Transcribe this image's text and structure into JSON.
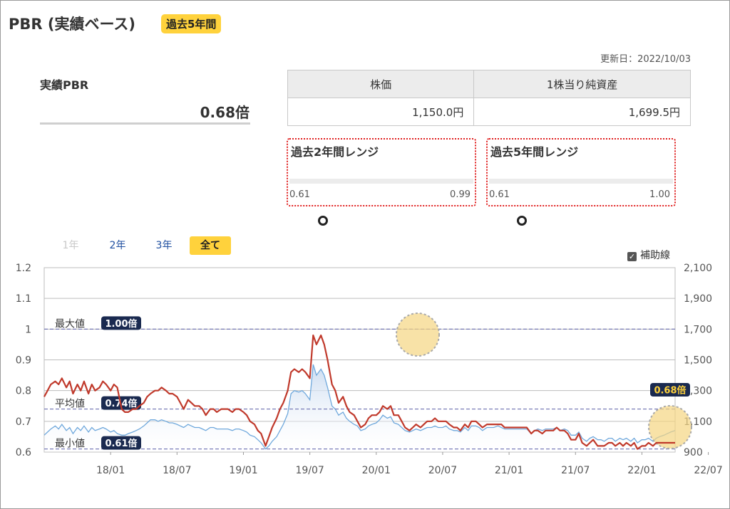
{
  "header": {
    "title": "PBR (実績ベース)",
    "period_badge": "過去5年間"
  },
  "updated": "更新日：2022/10/03",
  "pbr": {
    "label": "実績PBR",
    "value": "0.68倍"
  },
  "price_table": {
    "headers": [
      "株価",
      "1株当り純資産"
    ],
    "values": [
      "1,150.0円",
      "1,699.5円"
    ]
  },
  "ranges": [
    {
      "title": "過去2年間レンジ",
      "min": "0.61",
      "max": "0.99",
      "current": 0.68,
      "min_value": 0.61,
      "max_value": 0.99
    },
    {
      "title": "過去5年間レンジ",
      "min": "0.61",
      "max": "1.00",
      "current": 0.68,
      "min_value": 0.61,
      "max_value": 1.0
    }
  ],
  "tabs": [
    {
      "label": "1年",
      "state": "disabled"
    },
    {
      "label": "2年",
      "state": "link"
    },
    {
      "label": "3年",
      "state": "link"
    },
    {
      "label": "全て",
      "state": "active"
    }
  ],
  "aux_toggle": {
    "label": "補助線",
    "checked": true
  },
  "colors": {
    "pbr_line": "#c0392b",
    "price_line": "#6fa8dc",
    "price_fill": "#c9daf0",
    "badge": "#ffd23c",
    "label_bg": "#1a2a50",
    "highlight": "#f5d682"
  },
  "chart_data": {
    "type": "line",
    "x_tick_labels": [
      "18/01",
      "18/07",
      "19/01",
      "19/07",
      "20/01",
      "20/07",
      "21/01",
      "21/07",
      "22/01",
      "22/07"
    ],
    "y_left": {
      "ticks": [
        "1.2",
        "1.1",
        "1",
        "0.9",
        "0.8",
        "0.7",
        "0.6"
      ],
      "range": [
        0.6,
        1.2
      ]
    },
    "y_right": {
      "ticks": [
        "2,100",
        "1,900",
        "1,700",
        "1,500",
        "1,300",
        "1,100",
        "900"
      ],
      "range": [
        900,
        2100
      ]
    },
    "reference_lines": [
      {
        "label": "最大値",
        "badge": "1.00倍",
        "value": 1.0
      },
      {
        "label": "平均値",
        "badge": "0.74倍",
        "value": 0.74
      },
      {
        "label": "最小値",
        "badge": "0.61倍",
        "value": 0.61
      }
    ],
    "current_label": "0.68倍",
    "series": [
      {
        "axis": "left",
        "t": [
          0,
          0.3,
          0.6,
          1,
          1.3,
          1.6,
          2,
          2.3,
          2.6,
          3,
          3.3,
          3.6,
          4,
          4.3,
          4.6,
          5,
          5.3,
          5.6,
          6,
          6.3,
          6.6,
          7,
          7.3,
          7.6,
          8,
          8.3,
          8.6,
          9,
          9.3,
          9.6,
          10,
          10.3,
          10.6,
          11,
          11.3,
          11.6,
          12,
          12.3,
          12.6,
          13,
          13.3,
          13.6,
          14,
          14.3,
          14.6,
          15,
          15.3,
          15.6,
          16,
          16.3,
          16.6,
          17,
          17.3,
          17.6,
          18,
          18.3,
          18.6,
          19,
          19.3,
          19.6,
          20,
          20.3,
          20.6,
          21,
          21.3,
          21.6,
          22,
          22.3,
          22.6,
          23,
          23.3,
          23.6,
          24,
          24.3,
          24.6,
          25,
          25.3,
          25.6,
          26,
          26.3,
          26.6,
          27,
          27.3,
          27.6,
          28,
          28.3,
          28.6,
          29,
          29.3,
          29.6,
          30,
          30.3,
          30.6,
          31,
          31.3,
          31.6,
          32,
          32.3,
          32.6,
          33,
          33.3,
          33.6,
          34,
          34.3,
          34.6,
          35,
          35.3,
          35.6,
          36,
          36.3,
          36.6,
          37,
          37.3,
          37.6,
          38,
          38.3,
          38.6,
          39,
          39.3,
          39.6,
          40,
          40.3,
          40.6,
          41,
          41.3,
          41.6,
          42,
          42.3,
          42.6,
          43,
          43.3,
          43.6,
          44,
          44.3,
          44.6,
          45,
          45.3,
          45.6,
          46,
          46.3,
          46.6,
          47,
          47.3,
          47.6,
          48,
          48.3,
          48.6,
          49,
          49.3,
          49.6,
          50,
          50.3,
          50.6,
          51,
          51.3,
          51.6,
          52,
          52.3,
          52.6,
          53,
          53.3,
          53.6,
          54,
          54.3,
          54.6,
          55,
          55.3,
          55.6,
          56,
          56.3,
          56.6,
          57
        ],
        "values": [
          0.78,
          0.8,
          0.82,
          0.83,
          0.82,
          0.84,
          0.81,
          0.83,
          0.79,
          0.82,
          0.8,
          0.83,
          0.79,
          0.82,
          0.8,
          0.81,
          0.83,
          0.82,
          0.8,
          0.82,
          0.81,
          0.74,
          0.73,
          0.73,
          0.74,
          0.74,
          0.75,
          0.76,
          0.78,
          0.79,
          0.8,
          0.8,
          0.81,
          0.8,
          0.79,
          0.79,
          0.78,
          0.76,
          0.74,
          0.77,
          0.76,
          0.75,
          0.75,
          0.74,
          0.72,
          0.74,
          0.74,
          0.73,
          0.74,
          0.74,
          0.74,
          0.73,
          0.74,
          0.74,
          0.73,
          0.72,
          0.7,
          0.69,
          0.67,
          0.66,
          0.62,
          0.65,
          0.68,
          0.71,
          0.74,
          0.76,
          0.8,
          0.86,
          0.87,
          0.86,
          0.87,
          0.86,
          0.84,
          0.98,
          0.95,
          0.98,
          0.95,
          0.9,
          0.82,
          0.8,
          0.76,
          0.78,
          0.75,
          0.73,
          0.72,
          0.7,
          0.68,
          0.69,
          0.71,
          0.72,
          0.72,
          0.73,
          0.75,
          0.74,
          0.75,
          0.72,
          0.72,
          0.7,
          0.68,
          0.67,
          0.68,
          0.69,
          0.68,
          0.69,
          0.7,
          0.7,
          0.71,
          0.7,
          0.7,
          0.7,
          0.69,
          0.68,
          0.68,
          0.67,
          0.69,
          0.68,
          0.7,
          0.7,
          0.69,
          0.68,
          0.69,
          0.69,
          0.69,
          0.69,
          0.69,
          0.68,
          0.68,
          0.68,
          0.68,
          0.68,
          0.68,
          0.68,
          0.66,
          0.67,
          0.67,
          0.66,
          0.67,
          0.67,
          0.67,
          0.68,
          0.67,
          0.67,
          0.66,
          0.64,
          0.64,
          0.66,
          0.63,
          0.62,
          0.63,
          0.64,
          0.62,
          0.62,
          0.62,
          0.63,
          0.63,
          0.62,
          0.63,
          0.62,
          0.63,
          0.62,
          0.63,
          0.61,
          0.62,
          0.62,
          0.63,
          0.62,
          0.63,
          0.63,
          0.63,
          0.63,
          0.63,
          0.63,
          0.64,
          0.68
        ]
      },
      {
        "axis": "right",
        "t": [
          0,
          0.3,
          0.6,
          1,
          1.3,
          1.6,
          2,
          2.3,
          2.6,
          3,
          3.3,
          3.6,
          4,
          4.3,
          4.6,
          5,
          5.3,
          5.6,
          6,
          6.3,
          6.6,
          7,
          7.3,
          7.6,
          8,
          8.3,
          8.6,
          9,
          9.3,
          9.6,
          10,
          10.3,
          10.6,
          11,
          11.3,
          11.6,
          12,
          12.3,
          12.6,
          13,
          13.3,
          13.6,
          14,
          14.3,
          14.6,
          15,
          15.3,
          15.6,
          16,
          16.3,
          16.6,
          17,
          17.3,
          17.6,
          18,
          18.3,
          18.6,
          19,
          19.3,
          19.6,
          20,
          20.3,
          20.6,
          21,
          21.3,
          21.6,
          22,
          22.3,
          22.6,
          23,
          23.3,
          23.6,
          24,
          24.3,
          24.6,
          25,
          25.3,
          25.6,
          26,
          26.3,
          26.6,
          27,
          27.3,
          27.6,
          28,
          28.3,
          28.6,
          29,
          29.3,
          29.6,
          30,
          30.3,
          30.6,
          31,
          31.3,
          31.6,
          32,
          32.3,
          32.6,
          33,
          33.3,
          33.6,
          34,
          34.3,
          34.6,
          35,
          35.3,
          35.6,
          36,
          36.3,
          36.6,
          37,
          37.3,
          37.6,
          38,
          38.3,
          38.6,
          39,
          39.3,
          39.6,
          40,
          40.3,
          40.6,
          41,
          41.3,
          41.6,
          42,
          42.3,
          42.6,
          43,
          43.3,
          43.6,
          44,
          44.3,
          44.6,
          45,
          45.3,
          45.6,
          46,
          46.3,
          46.6,
          47,
          47.3,
          47.6,
          48,
          48.3,
          48.6,
          49,
          49.3,
          49.6,
          50,
          50.3,
          50.6,
          51,
          51.3,
          51.6,
          52,
          52.3,
          52.6,
          53,
          53.3,
          53.6,
          54,
          54.3,
          54.6,
          55,
          55.3,
          55.6,
          56,
          56.3,
          56.6,
          57
        ],
        "values": [
          1010,
          1030,
          1050,
          1070,
          1050,
          1080,
          1040,
          1060,
          1020,
          1060,
          1040,
          1070,
          1030,
          1060,
          1040,
          1050,
          1060,
          1050,
          1030,
          1040,
          1020,
          1010,
          1010,
          1020,
          1030,
          1040,
          1050,
          1070,
          1090,
          1110,
          1110,
          1100,
          1110,
          1100,
          1090,
          1090,
          1080,
          1070,
          1060,
          1080,
          1070,
          1060,
          1060,
          1050,
          1040,
          1060,
          1060,
          1050,
          1050,
          1050,
          1050,
          1040,
          1050,
          1050,
          1040,
          1030,
          1010,
          1000,
          980,
          960,
          920,
          940,
          970,
          1000,
          1040,
          1080,
          1150,
          1280,
          1300,
          1290,
          1300,
          1280,
          1240,
          1470,
          1400,
          1440,
          1400,
          1320,
          1200,
          1180,
          1140,
          1160,
          1120,
          1100,
          1080,
          1070,
          1040,
          1050,
          1070,
          1080,
          1090,
          1110,
          1140,
          1120,
          1130,
          1090,
          1080,
          1060,
          1040,
          1030,
          1040,
          1050,
          1040,
          1050,
          1060,
          1060,
          1070,
          1060,
          1060,
          1070,
          1050,
          1040,
          1040,
          1030,
          1060,
          1040,
          1070,
          1070,
          1060,
          1040,
          1060,
          1060,
          1060,
          1070,
          1060,
          1050,
          1050,
          1050,
          1050,
          1050,
          1050,
          1050,
          1020,
          1040,
          1050,
          1040,
          1050,
          1050,
          1050,
          1060,
          1040,
          1050,
          1040,
          1010,
          1010,
          1030,
          990,
          970,
          990,
          1000,
          980,
          980,
          970,
          990,
          990,
          970,
          990,
          980,
          990,
          970,
          990,
          960,
          980,
          980,
          990,
          970,
          990,
          1000,
          1010,
          1020,
          1030,
          1040,
          1050,
          1150
        ]
      }
    ]
  }
}
